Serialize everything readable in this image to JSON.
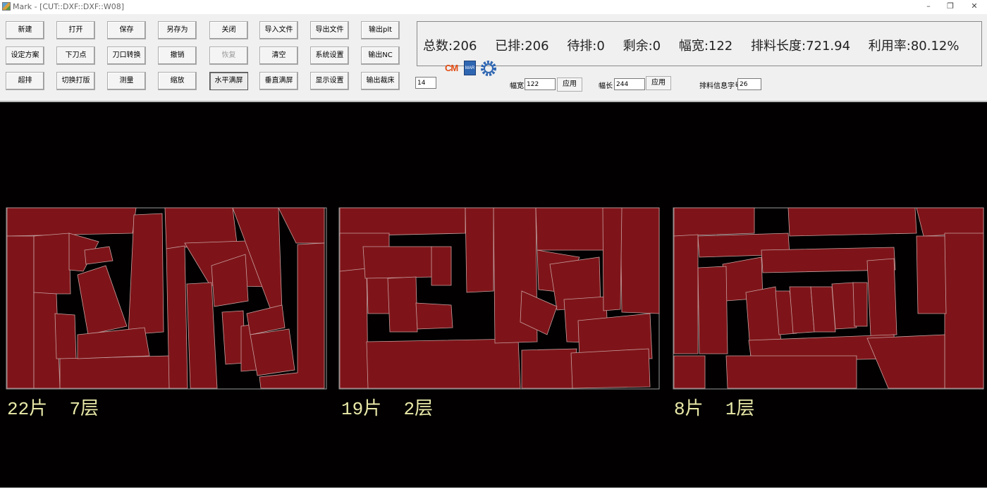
{
  "window": {
    "title": "Mark - [CUT::DXF::DXF::W08]",
    "controls": {
      "minimize": "–",
      "restore": "❐",
      "close": "✕"
    }
  },
  "toolbar": {
    "buttons": [
      [
        "新建",
        "打开",
        "保存",
        "另存为",
        "关闭",
        "导入文件",
        "导出文件",
        "输出plt"
      ],
      [
        "设定方案",
        "下刀点",
        "刀口转换",
        "撤销",
        "恢复",
        "清空",
        "系统设置",
        "输出NC"
      ],
      [
        "超排",
        "切换打版",
        "测量",
        "缩放",
        "水平满屏",
        "垂直满屏",
        "显示设置",
        "输出裁床"
      ]
    ],
    "disabled": [
      "恢复"
    ],
    "pressed": [
      "水平满屏"
    ]
  },
  "stats": {
    "total": "总数:206",
    "placed": "已排:206",
    "pending": "待排:0",
    "remaining": "剩余:0",
    "width": "幅宽:122",
    "length": "排料长度:721.94",
    "utilization": "利用率:80.12%"
  },
  "controls": {
    "gap_value": "14",
    "cm_icon": "CM",
    "doc_icon_label": "MAR",
    "width_label": "幅宽",
    "width_value": "122",
    "apply_label": "应用",
    "length_label": "幅长",
    "length_value": "244",
    "font_label": "排料信息字号",
    "font_value": "26"
  },
  "sheets": [
    {
      "pieces": "22片",
      "layers": "7层"
    },
    {
      "pieces": "19片",
      "layers": "2层"
    },
    {
      "pieces": "8片",
      "layers": "1层"
    }
  ],
  "colors": {
    "piece_fill": "#7e1419",
    "piece_stroke": "#c8a0a0",
    "canvas_bg": "#020000",
    "caption": "#e8e8a8"
  }
}
